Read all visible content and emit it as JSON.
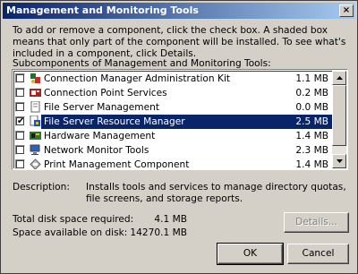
{
  "window": {
    "title": "Management and Monitoring Tools",
    "close_glyph": "×"
  },
  "intro_text": "To add or remove a component, click the check box. A shaded box means that only part of the component will be installed. To see what's included in a component, click Details.",
  "subcomponents_label": "Subcomponents of Management and Monitoring Tools:",
  "components": [
    {
      "name": "Connection Manager Administration Kit",
      "size": "1.1 MB",
      "checked": false,
      "selected": false,
      "icon": "connection-manager-icon"
    },
    {
      "name": "Connection Point Services",
      "size": "0.2 MB",
      "checked": false,
      "selected": false,
      "icon": "connection-point-icon"
    },
    {
      "name": "File Server Management",
      "size": "0.0 MB",
      "checked": false,
      "selected": false,
      "icon": "file-server-icon"
    },
    {
      "name": "File Server Resource Manager",
      "size": "2.5 MB",
      "checked": true,
      "selected": true,
      "icon": "resource-manager-icon"
    },
    {
      "name": "Hardware Management",
      "size": "1.4 MB",
      "checked": false,
      "selected": false,
      "icon": "hardware-icon"
    },
    {
      "name": "Network Monitor Tools",
      "size": "2.3 MB",
      "checked": false,
      "selected": false,
      "icon": "network-monitor-icon"
    },
    {
      "name": "Print Management Component",
      "size": "1.4 MB",
      "checked": false,
      "selected": false,
      "icon": "print-management-icon"
    }
  ],
  "description": {
    "label": "Description:",
    "text": "Installs tools and services to manage directory quotas, file screens, and storage reports."
  },
  "disk": {
    "required_label": "Total disk space required:",
    "required_value": "4.1 MB",
    "available_label": "Space available on disk:",
    "available_value": "14270.1 MB"
  },
  "buttons": {
    "details": "Details...",
    "ok": "OK",
    "cancel": "Cancel"
  },
  "colors": {
    "titlebar_start": "#0a246a",
    "titlebar_end": "#a6caf0",
    "selection": "#0a246a",
    "face": "#d4d0c8"
  }
}
